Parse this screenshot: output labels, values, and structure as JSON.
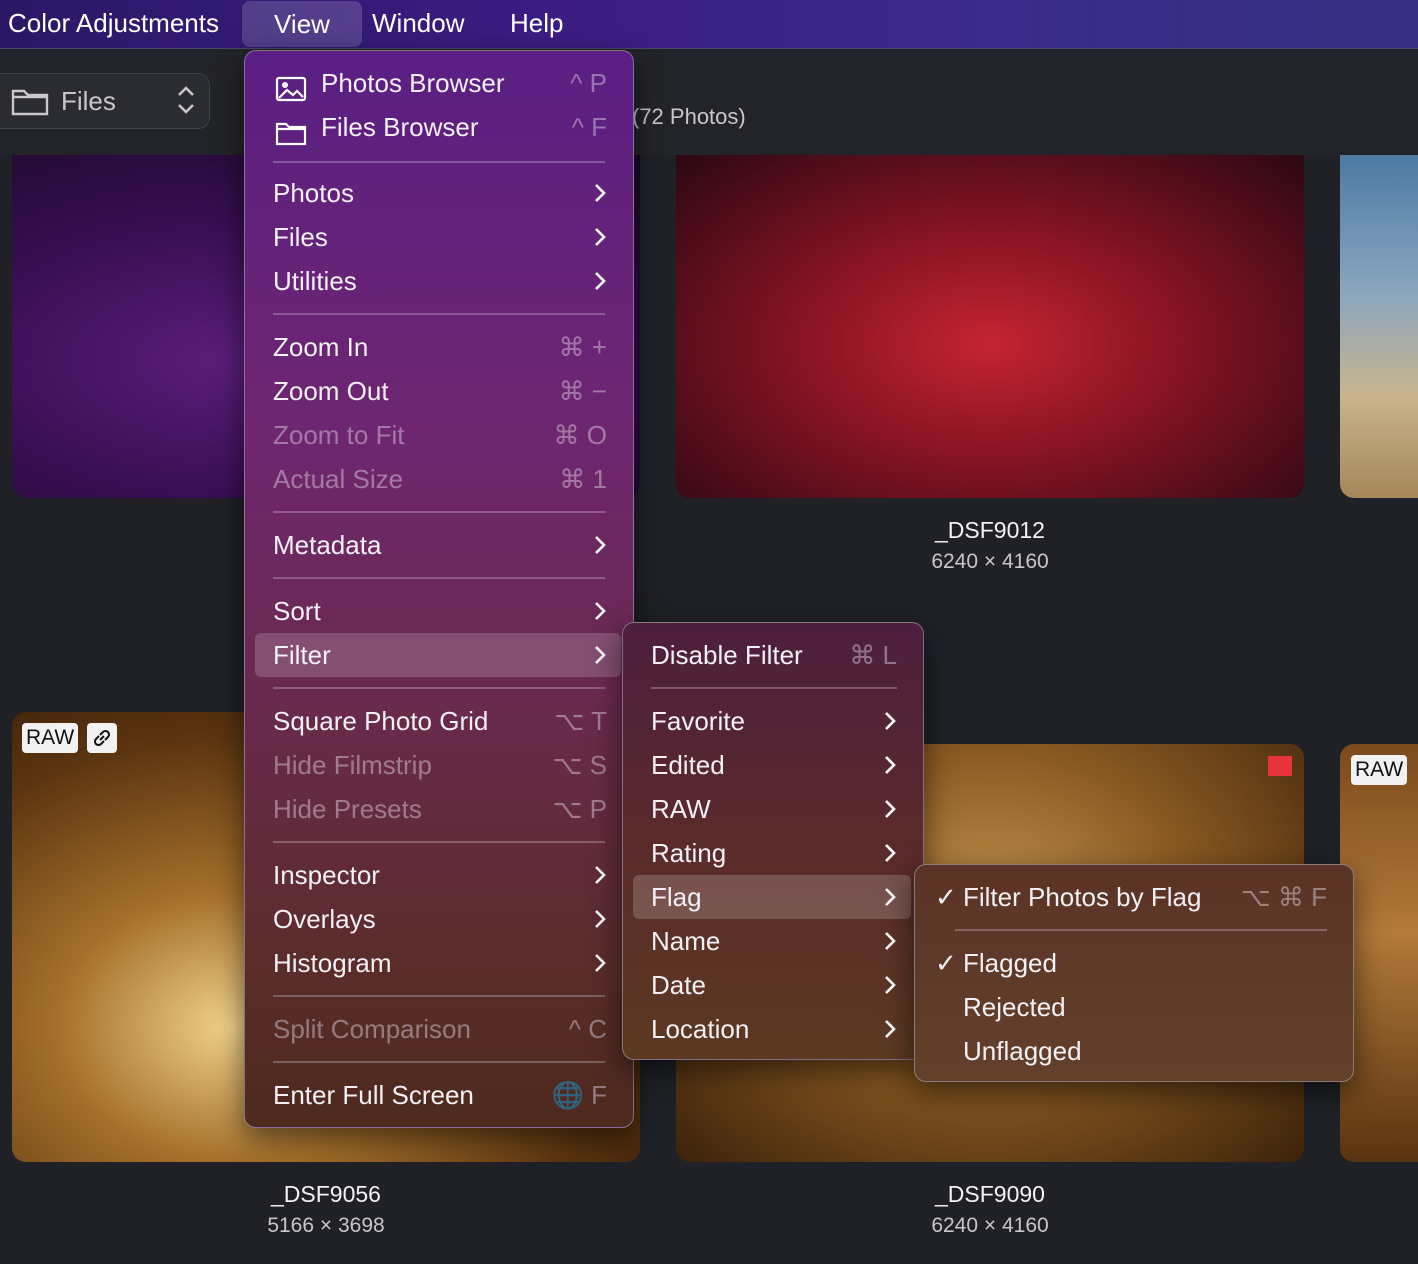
{
  "menubar": {
    "app": "Color Adjustments",
    "view": "View",
    "window": "Window",
    "help": "Help"
  },
  "toolbar": {
    "files_label": "Files",
    "photo_count": "(72 Photos)"
  },
  "thumbnails": {
    "badge_raw": "RAW",
    "items": [
      {
        "name": "_DSF9012",
        "dims": "6240 × 4160"
      },
      {
        "name": "_DSF9056",
        "dims": "5166 × 3698"
      },
      {
        "name": "_DSF9090",
        "dims": "6240 × 4160"
      }
    ]
  },
  "view_menu": {
    "items": [
      {
        "label": "Photos Browser",
        "shortcut": "^ P"
      },
      {
        "label": "Files Browser",
        "shortcut": "^ F"
      },
      {
        "label": "Photos"
      },
      {
        "label": "Files"
      },
      {
        "label": "Utilities"
      },
      {
        "label": "Zoom In",
        "shortcut": "⌘ +"
      },
      {
        "label": "Zoom Out",
        "shortcut": "⌘ −"
      },
      {
        "label": "Zoom to Fit",
        "shortcut": "⌘ O"
      },
      {
        "label": "Actual Size",
        "shortcut": "⌘ 1"
      },
      {
        "label": "Metadata"
      },
      {
        "label": "Sort"
      },
      {
        "label": "Filter"
      },
      {
        "label": "Square Photo Grid",
        "shortcut": "⌥ T"
      },
      {
        "label": "Hide Filmstrip",
        "shortcut": "⌥ S"
      },
      {
        "label": "Hide Presets",
        "shortcut": "⌥ P"
      },
      {
        "label": "Inspector"
      },
      {
        "label": "Overlays"
      },
      {
        "label": "Histogram"
      },
      {
        "label": "Split Comparison",
        "shortcut": "^ C"
      },
      {
        "label": "Enter Full Screen",
        "shortcut": "🌐 F"
      }
    ]
  },
  "filter_menu": {
    "items": [
      {
        "label": "Disable Filter",
        "shortcut": "⌘ L"
      },
      {
        "label": "Favorite"
      },
      {
        "label": "Edited"
      },
      {
        "label": "RAW"
      },
      {
        "label": "Rating"
      },
      {
        "label": "Flag"
      },
      {
        "label": "Name"
      },
      {
        "label": "Date"
      },
      {
        "label": "Location"
      }
    ]
  },
  "flag_menu": {
    "check": "✓",
    "items": [
      {
        "label": "Filter Photos by Flag",
        "shortcut": "⌥ ⌘ F",
        "checked": true
      },
      {
        "label": "Flagged",
        "checked": true
      },
      {
        "label": "Rejected",
        "checked": false
      },
      {
        "label": "Unflagged",
        "checked": false
      }
    ]
  }
}
